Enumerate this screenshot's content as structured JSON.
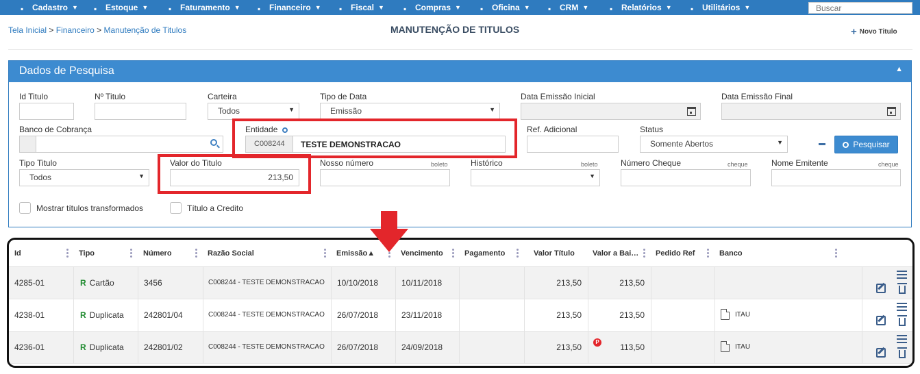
{
  "nav": {
    "items": [
      {
        "label": "Cadastro",
        "icon": "book-icon"
      },
      {
        "label": "Estoque",
        "icon": "cubes-icon"
      },
      {
        "label": "Faturamento",
        "icon": "list-icon"
      },
      {
        "label": "Financeiro",
        "icon": "money-icon"
      },
      {
        "label": "Fiscal",
        "icon": "building-icon"
      },
      {
        "label": "Compras",
        "icon": "truck-icon"
      },
      {
        "label": "Oficina",
        "icon": "wrench-icon"
      },
      {
        "label": "CRM",
        "icon": "users-icon"
      },
      {
        "label": "Relatórios",
        "icon": "print-icon"
      },
      {
        "label": "Utilitários",
        "icon": "bolt-icon"
      }
    ],
    "search_placeholder": "Buscar"
  },
  "header": {
    "breadcrumb": [
      "Tela Inicial",
      "Financeiro",
      "Manutenção de Titulos"
    ],
    "breadcrumb_sep": ">",
    "title": "MANUTENÇÃO DE TITULOS",
    "new_button": "Novo Titulo"
  },
  "search_panel": {
    "title": "Dados de Pesquisa",
    "fields": {
      "id_titulo": {
        "label": "Id Titulo",
        "value": ""
      },
      "numero_titulo": {
        "label": "Nº Titulo",
        "value": ""
      },
      "carteira": {
        "label": "Carteira",
        "value": "Todos"
      },
      "tipo_data": {
        "label": "Tipo de Data",
        "value": "Emissão"
      },
      "data_emissao_inicial": {
        "label": "Data Emissão Inicial",
        "value": ""
      },
      "data_emissao_final": {
        "label": "Data Emissão Final",
        "value": ""
      },
      "banco_cobranca": {
        "label": "Banco de Cobrança",
        "value": ""
      },
      "entidade": {
        "label": "Entidade",
        "code": "C008244",
        "name": "TESTE DEMONSTRACAO"
      },
      "ref_adicional": {
        "label": "Ref. Adicional",
        "value": ""
      },
      "status": {
        "label": "Status",
        "value": "Somente Abertos"
      },
      "tipo_titulo": {
        "label": "Tipo Titulo",
        "value": "Todos"
      },
      "valor_titulo": {
        "label": "Valor do Titulo",
        "value": "213,50"
      },
      "nosso_numero": {
        "label": "Nosso número",
        "hint": "boleto",
        "value": ""
      },
      "historico": {
        "label": "Histórico",
        "hint": "boleto",
        "value": ""
      },
      "numero_cheque": {
        "label": "Número Cheque",
        "hint": "cheque",
        "value": ""
      },
      "nome_emitente": {
        "label": "Nome Emitente",
        "hint": "cheque",
        "value": ""
      }
    },
    "checkboxes": {
      "mostrar_transformados": "Mostrar títulos transformados",
      "titulo_credito": "Título a Credito"
    },
    "search_button": "Pesquisar"
  },
  "grid": {
    "columns": [
      "Id",
      "Tipo",
      "Número",
      "Razão Social",
      "Emissão▲",
      "Vencimento",
      "Pagamento",
      "Valor Título",
      "Valor a Bai…",
      "Pedido Ref",
      "Banco"
    ],
    "rows": [
      {
        "id": "4285-01",
        "tipo_badge": "R",
        "tipo": "Cartão",
        "numero": "3456",
        "razao": "C008244 - TESTE DEMONSTRACAO",
        "emissao": "10/10/2018",
        "vencimento": "10/11/2018",
        "pagamento": "",
        "valor": "213,50",
        "valor_baixar": "213,50",
        "pedido": "",
        "banco": "",
        "p_badge": ""
      },
      {
        "id": "4238-01",
        "tipo_badge": "R",
        "tipo": "Duplicata",
        "numero": "242801/04",
        "razao": "C008244 - TESTE DEMONSTRACAO",
        "emissao": "26/07/2018",
        "vencimento": "23/11/2018",
        "pagamento": "",
        "valor": "213,50",
        "valor_baixar": "213,50",
        "pedido": "",
        "banco": "ITAU",
        "p_badge": ""
      },
      {
        "id": "4236-01",
        "tipo_badge": "R",
        "tipo": "Duplicata",
        "numero": "242801/02",
        "razao": "C008244 - TESTE DEMONSTRACAO",
        "emissao": "26/07/2018",
        "vencimento": "24/09/2018",
        "pagamento": "",
        "valor": "213,50",
        "valor_baixar": "113,50",
        "pedido": "",
        "banco": "ITAU",
        "p_badge": "P"
      }
    ]
  },
  "colors": {
    "nav_bg": "#2f7bbf",
    "panel_head": "#3d8bd0",
    "highlight": "#e3262b",
    "badge_green": "#1e8a2e"
  }
}
